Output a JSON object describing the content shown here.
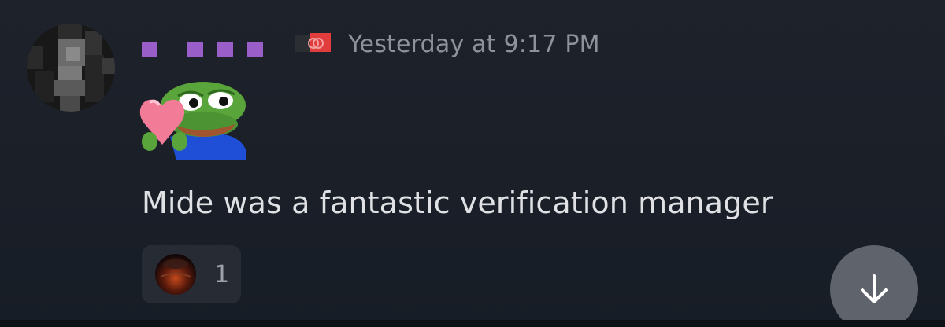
{
  "message": {
    "timestamp": "Yesterday at 9:17 PM",
    "text": "Mide was a fantastic verification manager",
    "sticker_icon": "pepe-heart-sticker",
    "reaction": {
      "icon": "dark-orb-emoji",
      "count": "1"
    }
  },
  "jump_button": {
    "icon": "arrow-down-icon"
  },
  "colors": {
    "background": "#1b2028",
    "username": "#9a5ec9",
    "timestamp": "#8d929b",
    "text": "#dfe1e5",
    "reaction_bg": "#262b34",
    "jump_button_bg": "#5f646c"
  }
}
